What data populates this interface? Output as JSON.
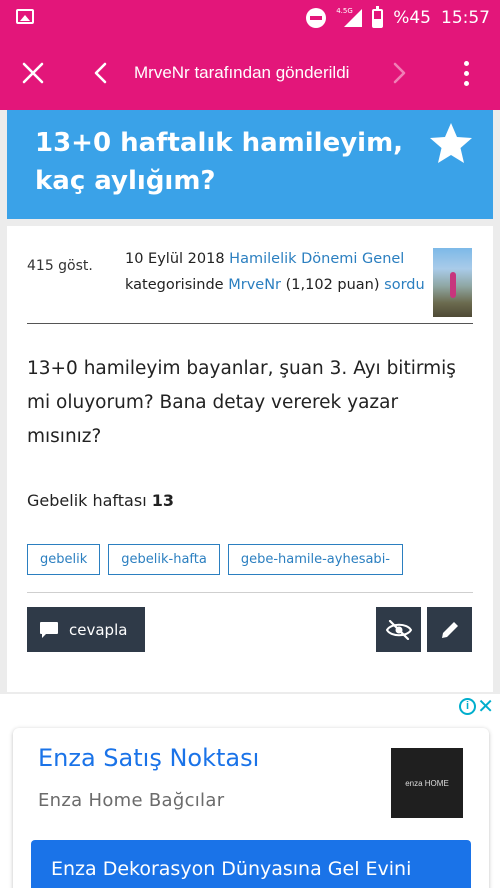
{
  "status_bar": {
    "network_tag": "4.5G",
    "battery": "%45",
    "time": "15:57",
    "icons": [
      "image-icon",
      "do-not-disturb-icon",
      "signal-icon",
      "battery-icon"
    ]
  },
  "toolbar": {
    "title": "MrveNr tarafından gönderildi",
    "icons": [
      "close-icon",
      "back-arrow-icon",
      "forward-arrow-icon",
      "more-vert-icon"
    ]
  },
  "question": {
    "title": "13+0 haftalık hamileyim, kaç aylığım?",
    "views": "415 göst.",
    "meta": {
      "date": "10 Eylül 2018",
      "category": "Hamilelik Dönemi Genel",
      "category_suffix": "kategorisinde",
      "user": "MrveNr",
      "points": "(1,102 puan)",
      "asked": "sordu"
    },
    "body": "13+0 hamileyim bayanlar, şuan 3. Ayı bitirmiş mi oluyorum?  Bana detay vererek yazar mısınız?",
    "week_label": "Gebelik haftası",
    "week_value": "13",
    "tags": [
      "gebelik",
      "gebelik-hafta",
      "gebe-hamile-ayhesabi-"
    ],
    "reply_label": "cevapla"
  },
  "ad": {
    "title": "Enza Satış Noktası",
    "subtitle": "Enza Home Bağcılar",
    "logo_text": "enza HOME",
    "cta": "Enza Dekorasyon Dünyasına Gel Evini"
  },
  "colors": {
    "toolbar": "#e3167a",
    "title_banner": "#3aa2e8",
    "link": "#2b7fc0",
    "button_dark": "#2f3a48",
    "ad_blue": "#1a73e8",
    "ad_icon": "#00aecd"
  }
}
